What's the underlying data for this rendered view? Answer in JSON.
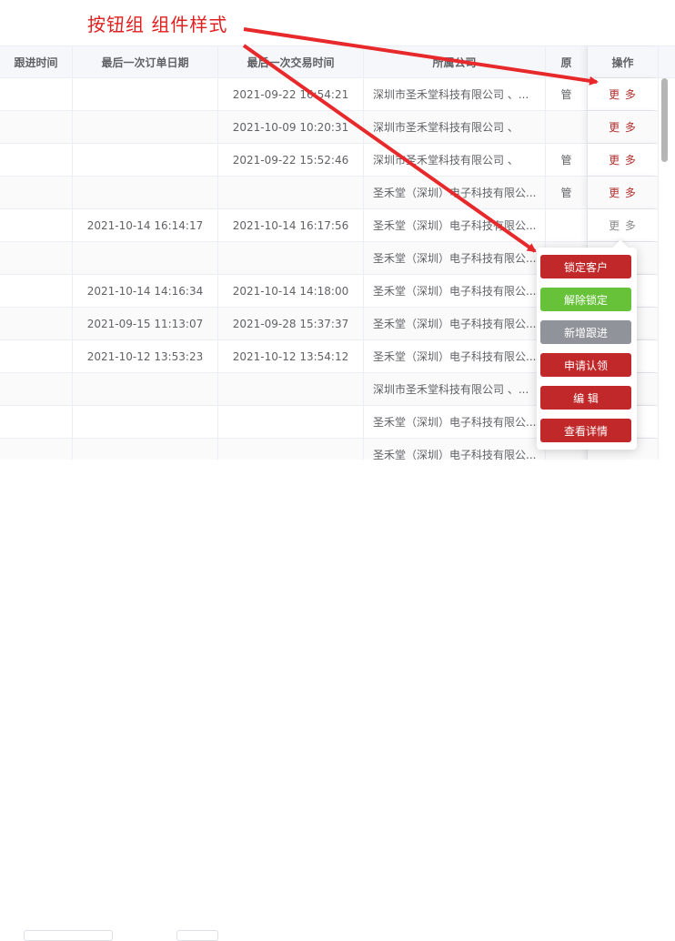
{
  "annotation": {
    "title": "按钮组 组件样式",
    "color": "#e02020"
  },
  "table": {
    "columns": [
      "跟进时间",
      "最后一次订单日期",
      "最后一次交易时间",
      "所属公司",
      "原",
      "操作"
    ],
    "rows": [
      {
        "c0": "",
        "c1": "",
        "c2": "2021-09-22 16:54:21",
        "c3": "深圳市圣禾堂科技有限公司 、...",
        "c4": "管",
        "more": "更 多"
      },
      {
        "c0": "",
        "c1": "",
        "c2": "2021-10-09 10:20:31",
        "c3": "深圳市圣禾堂科技有限公司 、",
        "c4": "",
        "more": "更 多"
      },
      {
        "c0": "",
        "c1": "",
        "c2": "2021-09-22 15:52:46",
        "c3": "深圳市圣禾堂科技有限公司 、",
        "c4": "管",
        "more": "更 多"
      },
      {
        "c0": "",
        "c1": "",
        "c2": "",
        "c3": "圣禾堂（深圳）电子科技有限公...",
        "c4": "管",
        "more": "更 多"
      },
      {
        "c0": "",
        "c1": "2021-10-14 16:14:17",
        "c2": "2021-10-14 16:17:56",
        "c3": "圣禾堂（深圳）电子科技有限公...",
        "c4": "",
        "more": "更 多"
      },
      {
        "c0": "",
        "c1": "",
        "c2": "",
        "c3": "圣禾堂（深圳）电子科技有限公...",
        "c4": "",
        "more": ""
      },
      {
        "c0": "",
        "c1": "2021-10-14 14:16:34",
        "c2": "2021-10-14 14:18:00",
        "c3": "圣禾堂（深圳）电子科技有限公...",
        "c4": "",
        "more": ""
      },
      {
        "c0": "",
        "c1": "2021-09-15 11:13:07",
        "c2": "2021-09-28 15:37:37",
        "c3": "圣禾堂（深圳）电子科技有限公...",
        "c4": "",
        "more": ""
      },
      {
        "c0": "",
        "c1": "2021-10-12 13:53:23",
        "c2": "2021-10-12 13:54:12",
        "c3": "圣禾堂（深圳）电子科技有限公...",
        "c4": "",
        "more": ""
      },
      {
        "c0": "",
        "c1": "",
        "c2": "",
        "c3": "深圳市圣禾堂科技有限公司 、...",
        "c4": "",
        "more": ""
      },
      {
        "c0": "",
        "c1": "",
        "c2": "",
        "c3": "圣禾堂（深圳）电子科技有限公...",
        "c4": "",
        "more": ""
      },
      {
        "c0": "",
        "c1": "",
        "c2": "",
        "c3": "圣禾堂（深圳）电子科技有限公...",
        "c4": "",
        "more": ""
      }
    ]
  },
  "dropdown": {
    "buttons": [
      {
        "label": "锁定客户",
        "color": "#c0282a"
      },
      {
        "label": "解除锁定",
        "color": "#67c23a"
      },
      {
        "label": "新增跟进",
        "color": "#909399"
      },
      {
        "label": "申请认领",
        "color": "#c0282a"
      },
      {
        "label": "编 辑",
        "color": "#c0282a"
      },
      {
        "label": "查看详情",
        "color": "#c0282a"
      }
    ]
  },
  "colors": {
    "more_link": "#b0302e",
    "header_bg": "#f5f7fa",
    "border": "#ebeef5"
  }
}
